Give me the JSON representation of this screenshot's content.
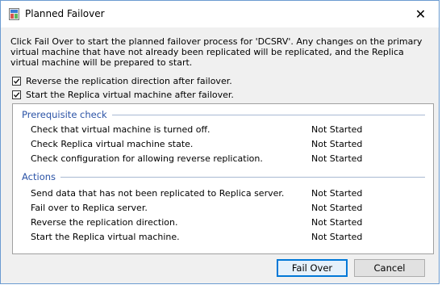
{
  "window": {
    "title": "Planned Failover",
    "close_glyph": "✕"
  },
  "intro_text": "Click Fail Over to start the planned failover process for 'DCSRV'. Any changes on the primary virtual machine that have not already been replicated will be replicated, and the Replica virtual machine will be prepared to start.",
  "options": [
    {
      "label": "Reverse the replication direction after failover.",
      "checked": true
    },
    {
      "label": "Start the Replica virtual machine after failover.",
      "checked": true
    }
  ],
  "sections": {
    "prereq": {
      "title": "Prerequisite check",
      "tasks": [
        {
          "label": "Check that virtual machine is turned off.",
          "status": "Not Started"
        },
        {
          "label": "Check Replica virtual machine state.",
          "status": "Not Started"
        },
        {
          "label": "Check configuration for allowing reverse replication.",
          "status": "Not Started"
        }
      ]
    },
    "actions": {
      "title": "Actions",
      "tasks": [
        {
          "label": "Send data that has not been replicated to Replica server.",
          "status": "Not Started"
        },
        {
          "label": "Fail over to Replica server.",
          "status": "Not Started"
        },
        {
          "label": "Reverse the replication direction.",
          "status": "Not Started"
        },
        {
          "label": "Start the Replica virtual machine.",
          "status": "Not Started"
        }
      ]
    }
  },
  "buttons": {
    "fail_over": "Fail Over",
    "cancel": "Cancel"
  },
  "icons": {
    "app": "hyper-v-replica-icon",
    "close": "close-icon",
    "checkmark": "checkmark-icon"
  },
  "colors": {
    "section_header": "#2b53a6",
    "default_button_border": "#0078d7",
    "window_border": "#6b9bd1"
  }
}
